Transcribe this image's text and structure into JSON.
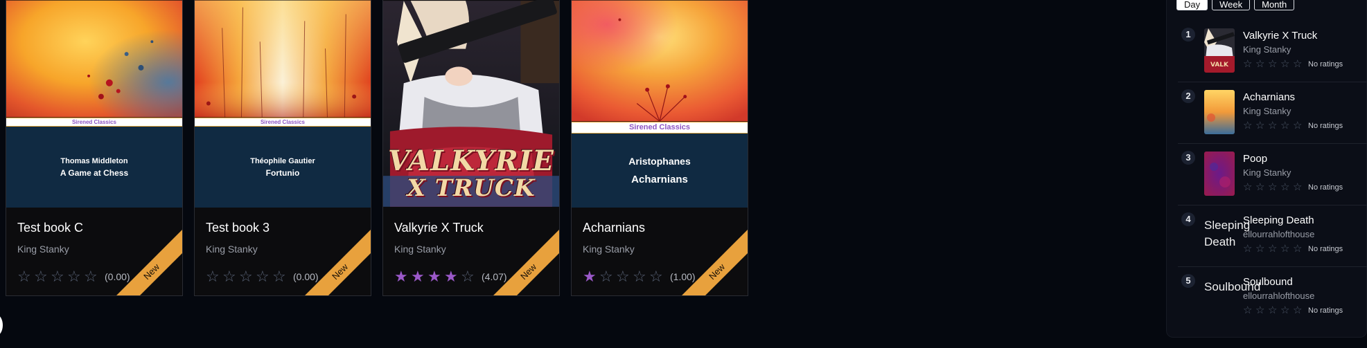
{
  "books": [
    {
      "title": "Test book C",
      "author": "King Stanky",
      "rating_value": "(0.00)",
      "stars_filled": 0,
      "badge": "New",
      "cover": {
        "series": "Sirened Classics",
        "author": "Thomas Middleton",
        "title": "A Game at Chess"
      }
    },
    {
      "title": "Test book 3",
      "author": "King Stanky",
      "rating_value": "(0.00)",
      "stars_filled": 0,
      "badge": "New",
      "cover": {
        "series": "Sirened Classics",
        "author": "Théophile Gautier",
        "title": "Fortunio"
      }
    },
    {
      "title": "Valkyrie X Truck",
      "author": "King Stanky",
      "rating_value": "(4.07)",
      "stars_filled": 4,
      "badge": "New",
      "cover": {
        "title_line1": "VALKYRIE",
        "title_line2": "X TRUCK"
      }
    },
    {
      "title": "Acharnians",
      "author": "King Stanky",
      "rating_value": "(1.00)",
      "stars_filled": 1,
      "badge": "New",
      "cover": {
        "series": "Sirened Classics",
        "author": "Aristophanes",
        "title": "Acharnians"
      }
    }
  ],
  "trending": {
    "tabs": [
      {
        "label": "Day",
        "active": true
      },
      {
        "label": "Week",
        "active": false
      },
      {
        "label": "Month",
        "active": false
      }
    ],
    "items": [
      {
        "rank": "1",
        "title": "Valkyrie X Truck",
        "author": "King Stanky",
        "rating_text": "No ratings",
        "thumb": "valkyrie"
      },
      {
        "rank": "2",
        "title": "Acharnians",
        "author": "King Stanky",
        "rating_text": "No ratings",
        "thumb": "orange"
      },
      {
        "rank": "3",
        "title": "Poop",
        "author": "King Stanky",
        "rating_text": "No ratings",
        "thumb": "purple"
      },
      {
        "rank": "4",
        "title": "Sleeping Death",
        "author": "ellourrahlofthouse",
        "rating_text": "No ratings",
        "thumb_text": "Sleeping Death"
      },
      {
        "rank": "5",
        "title": "Soulbound",
        "author": "ellourrahlofthouse",
        "rating_text": "No ratings",
        "thumb_text": "Soulbound"
      }
    ]
  },
  "colors": {
    "background": "#05080f",
    "star_filled": "#9b59c9",
    "ribbon": "#e8a13d",
    "cover_plate": "#102a42"
  }
}
